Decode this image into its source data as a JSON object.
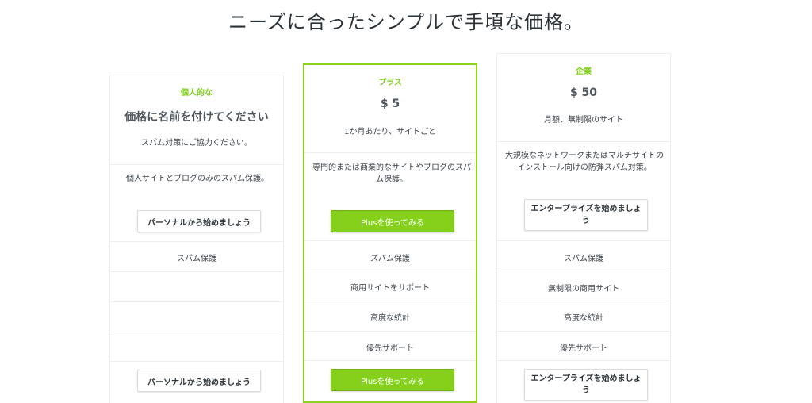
{
  "headline": "ニーズに合ったシンプルで手頃な価格。",
  "plans": [
    {
      "name": "個人的な",
      "price": "価格に名前を付けてください",
      "tagline": "スパム対策にご協力ください。",
      "description": "個人サイトとブログのみのスパム保護。",
      "cta": "パーソナルから始めましょう",
      "features": [
        "スパム保護",
        "",
        "",
        ""
      ]
    },
    {
      "name": "プラス",
      "price": "$ 5",
      "tagline": "1か月あたり、サイトごと",
      "description": "専門的または商業的なサイトやブログのスパム保護。",
      "cta": "Plusを使ってみる",
      "features": [
        "スパム保護",
        "商用サイトをサポート",
        "高度な統計",
        "優先サポート"
      ]
    },
    {
      "name": "企業",
      "price": "$ 50",
      "tagline": "月額、無制限のサイト",
      "description": "大規模なネットワークまたはマルチサイトのインストール向けの防弾スパム対策。",
      "cta": "エンタープライズを始めましょう",
      "features": [
        "スパム保護",
        "無制限の商用サイト",
        "高度な統計",
        "優先サポート"
      ]
    }
  ],
  "colors": {
    "accent": "#84d01b",
    "plan_name": "#7ccf12",
    "border": "#eeeeee"
  }
}
